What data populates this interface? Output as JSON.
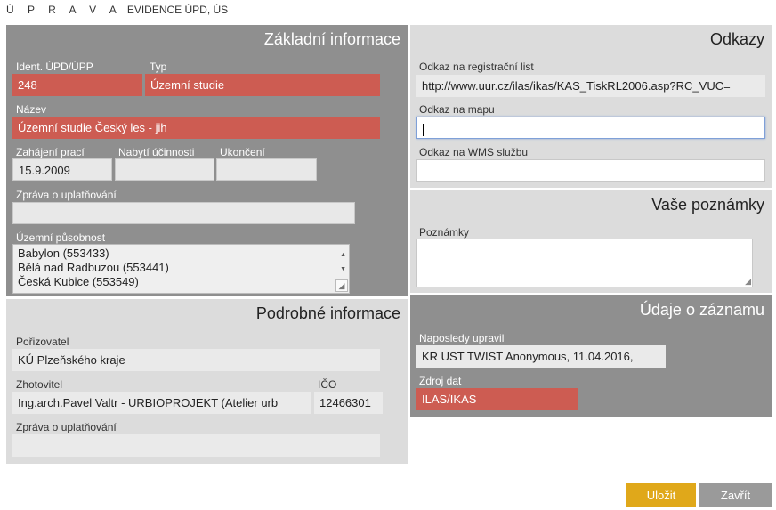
{
  "header": {
    "spaced": "Ú P R A V A",
    "rest": "EVIDENCE ÚPD, ÚS"
  },
  "basic": {
    "title": "Základní informace",
    "ident_label": "Ident. ÚPD/ÚPP",
    "ident_value": "248",
    "type_label": "Typ",
    "type_value": "Územní studie",
    "name_label": "Název",
    "name_value": "Územní studie Český les - jih",
    "start_label": "Zahájení prací",
    "start_value": "15.9.2009",
    "effective_label": "Nabytí účinnosti",
    "effective_value": "",
    "end_label": "Ukončení",
    "end_value": "",
    "report_label": "Zpráva o uplatňování",
    "report_value": "",
    "territory_label": "Územní působnost",
    "territory_items": [
      "Babylon (553433)",
      "Bělá nad Radbuzou (553441)",
      "Česká Kubice (553549)"
    ]
  },
  "detail": {
    "title": "Podrobné informace",
    "acquirer_label": "Pořizovatel",
    "acquirer_value": "KÚ Plzeňského kraje",
    "maker_label": "Zhotovitel",
    "maker_value": "Ing.arch.Pavel Valtr - URBIOPROJEKT (Atelier urb",
    "ico_label": "IČO",
    "ico_value": "12466301",
    "report_label": "Zpráva o uplatňování",
    "report_value": ""
  },
  "links": {
    "title": "Odkazy",
    "reg_label": "Odkaz na registrační list",
    "reg_value": "http://www.uur.cz/ilas/ikas/KAS_TiskRL2006.asp?RC_VUC=",
    "map_label": "Odkaz na mapu",
    "map_value": "",
    "wms_label": "Odkaz na WMS službu",
    "wms_value": ""
  },
  "notes": {
    "title": "Vaše poznámky",
    "label": "Poznámky"
  },
  "record": {
    "title": "Údaje o záznamu",
    "updated_label": "Naposledy upravil",
    "updated_value": "KR UST TWIST Anonymous, 11.04.2016,",
    "source_label": "Zdroj dat",
    "source_value": "ILAS/IKAS"
  },
  "buttons": {
    "save": "Uložit",
    "close": "Zavřít"
  },
  "colors": {
    "required_field": "#cd5c52",
    "save_button": "#e0a81a",
    "close_button": "#9a9a9a",
    "dark_panel": "#8f8f8f",
    "light_panel": "#dcdcdc"
  }
}
